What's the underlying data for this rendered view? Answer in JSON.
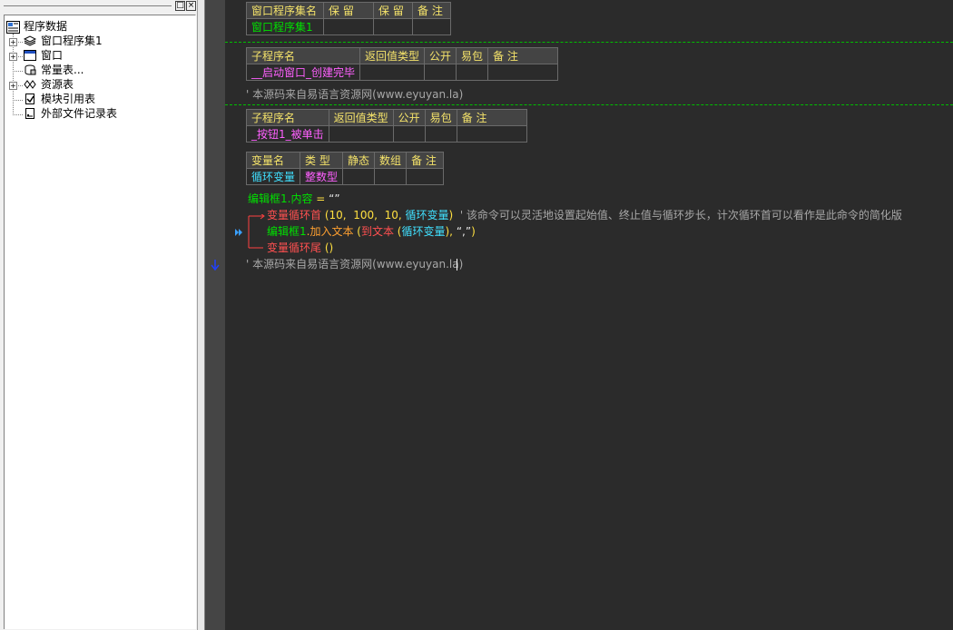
{
  "tree": {
    "root_label": "程序数据",
    "items": [
      {
        "label": "窗口程序集1",
        "expandable": true
      },
      {
        "label": "窗口",
        "expandable": true
      },
      {
        "label": "常量表...",
        "expandable": false
      },
      {
        "label": "资源表",
        "expandable": true
      },
      {
        "label": "模块引用表",
        "expandable": false
      },
      {
        "label": "外部文件记录表",
        "expandable": false
      }
    ]
  },
  "window_buttons": {
    "restore": "□",
    "close": "×"
  },
  "assembly_table": {
    "headers": [
      "窗口程序集名",
      "保 留",
      "保 留",
      "备 注"
    ],
    "row": [
      "窗口程序集1",
      "",
      "",
      ""
    ]
  },
  "sub1_table": {
    "headers": [
      "子程序名",
      "返回值类型",
      "公开",
      "易包",
      "备 注"
    ],
    "row": [
      "__启动窗口_创建完毕",
      "",
      "",
      "",
      ""
    ]
  },
  "comment1": "' 本源码来自易语言资源网(www.eyuyan.la)",
  "sub2_table": {
    "headers": [
      "子程序名",
      "返回值类型",
      "公开",
      "易包",
      "备 注"
    ],
    "row": [
      "_按钮1_被单击",
      "",
      "",
      "",
      ""
    ]
  },
  "var_table": {
    "headers": [
      "变量名",
      "类 型",
      "静态",
      "数组",
      "备 注"
    ],
    "row": [
      "循环变量",
      "整数型",
      "",
      "",
      ""
    ]
  },
  "code": {
    "line1": {
      "target": "编辑框1.内容",
      "op": " = ",
      "value": "“”"
    },
    "line2": {
      "cmd": "变量循环首",
      "args_open": " (10,  100,  10, ",
      "var": "循环变量",
      "args_close": ")",
      "comment": "  ' 该命令可以灵活地设置起始值、终止值与循环步长，计次循环首可以看作是此命令的简化版"
    },
    "line3": {
      "obj": "编辑框1",
      "method": ".加入文本",
      "open": " (",
      "fn": "到文本",
      "fn_open": " (",
      "var": "循环变量",
      "rest_close": "),",
      "str": " “,”",
      "close": ")"
    },
    "line4": {
      "cmd": "变量循环尾",
      "args": " ()"
    },
    "line5": "' 本源码来自易语言资源网(www.eyuyan.la)"
  },
  "colors": {
    "editor_bg": "#2b2b2b",
    "header_text": "#f5e36a",
    "separator": "#00c000",
    "loop_bracket": "#ff4040"
  }
}
